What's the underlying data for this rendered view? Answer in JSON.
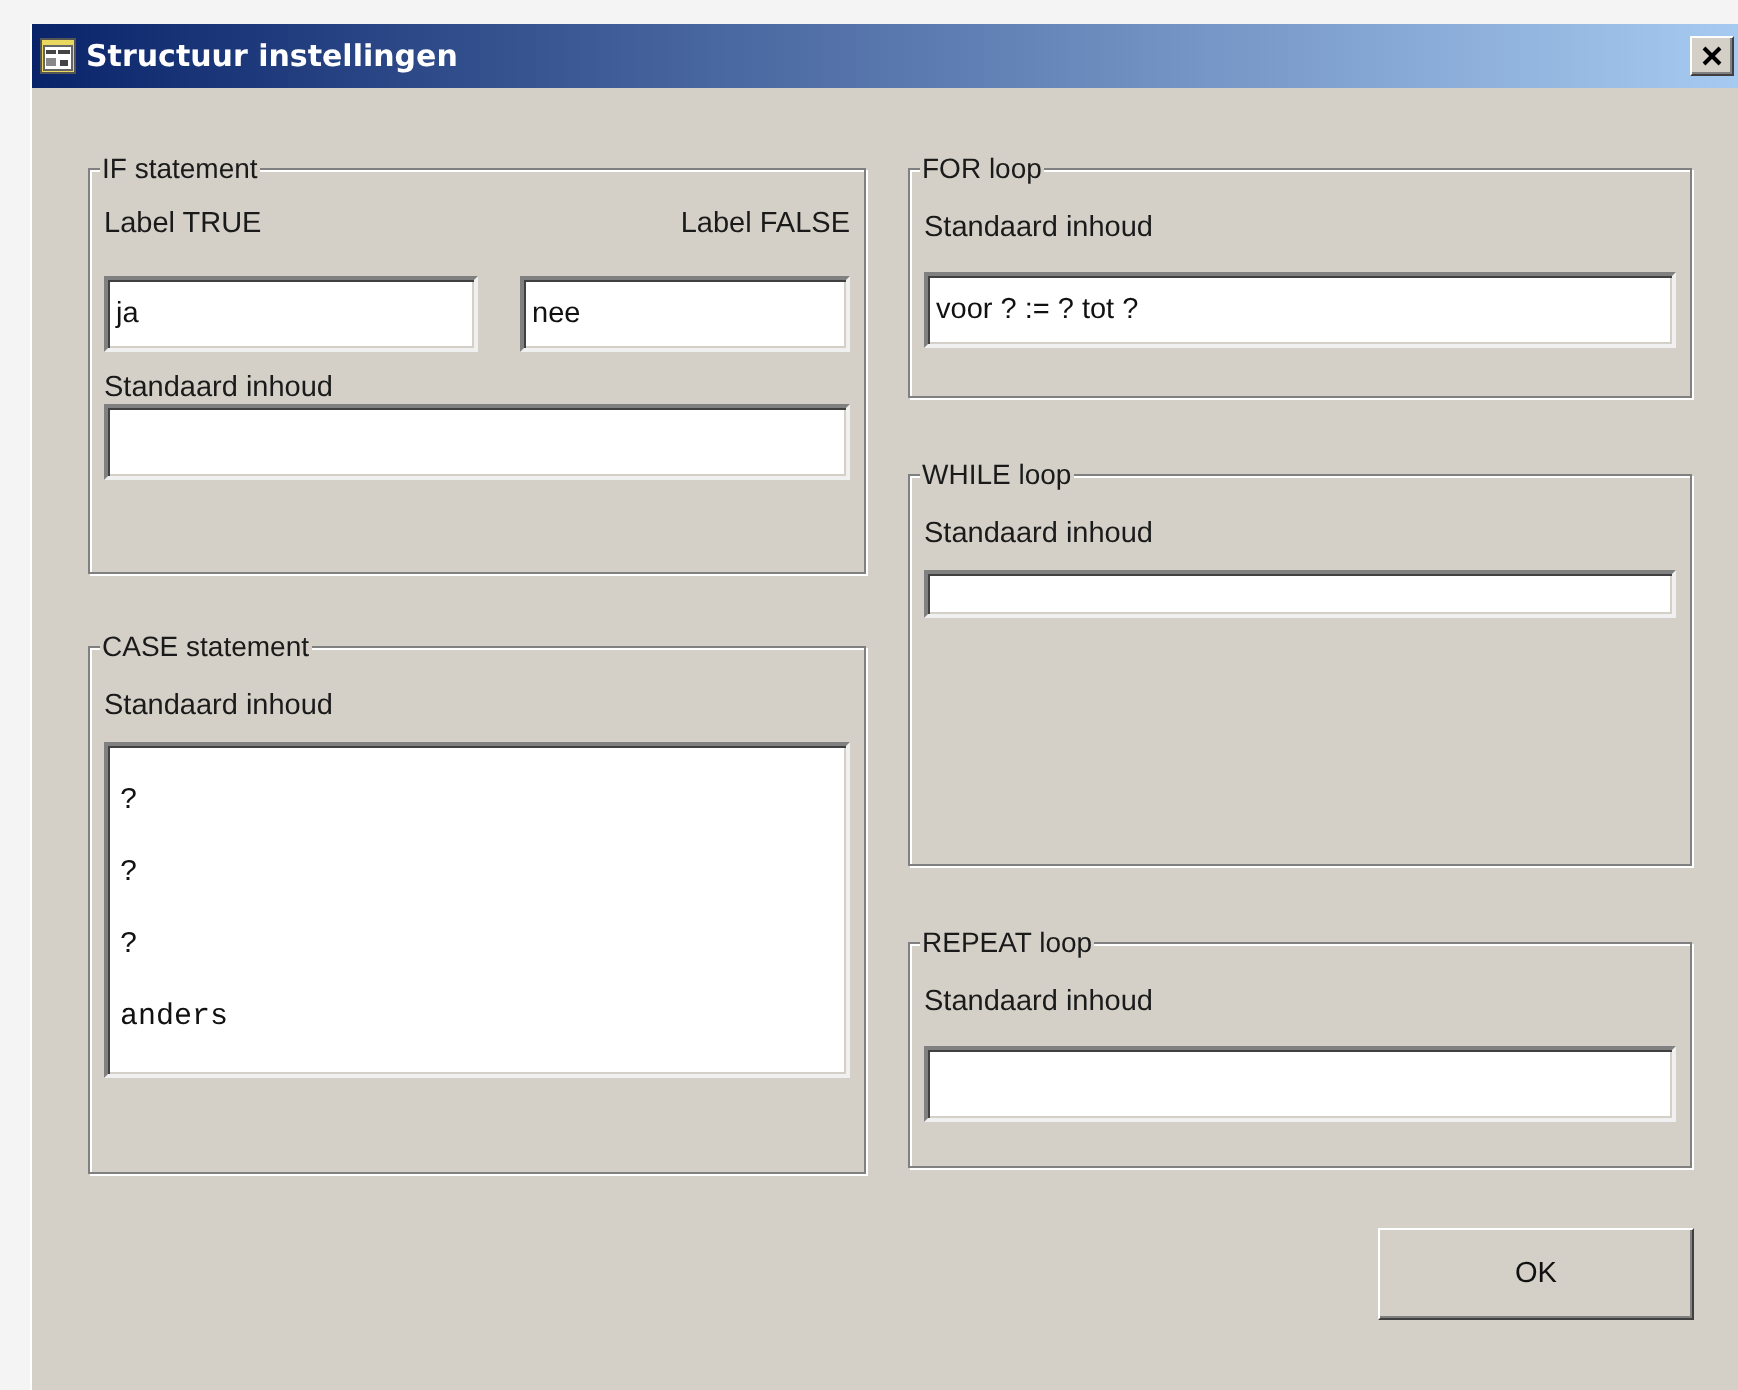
{
  "window": {
    "title": "Structuur instellingen"
  },
  "left_column": [
    {
      "title": "IF statement",
      "items": [
        {
          "kind": "label_pair",
          "left": "Label TRUE",
          "right": "Label FALSE"
        },
        {
          "kind": "field_pair",
          "values": [
            "ja",
            "nee"
          ]
        },
        {
          "kind": "label",
          "text": "Standaard inhoud"
        },
        {
          "kind": "field"
        }
      ]
    },
    {
      "title": "CASE statement",
      "items": [
        {
          "kind": "label",
          "text": "Standaard inhoud"
        },
        {
          "kind": "textarea",
          "lines": [
            "?",
            "?",
            "?",
            "anders"
          ]
        }
      ]
    }
  ],
  "right_column": [
    {
      "title": "FOR loop",
      "items": [
        {
          "kind": "label",
          "text": "Standaard inhoud"
        },
        {
          "kind": "field",
          "value": "voor ? := ? tot ?"
        }
      ]
    },
    {
      "title": "WHILE loop",
      "items": [
        {
          "kind": "label",
          "text": "Standaard inhoud"
        },
        {
          "kind": "textarea"
        }
      ]
    },
    {
      "title": "REPEAT loop",
      "items": [
        {
          "kind": "label",
          "text": "Standaard inhoud"
        },
        {
          "kind": "field"
        }
      ]
    }
  ],
  "buttons": [
    "OK"
  ]
}
